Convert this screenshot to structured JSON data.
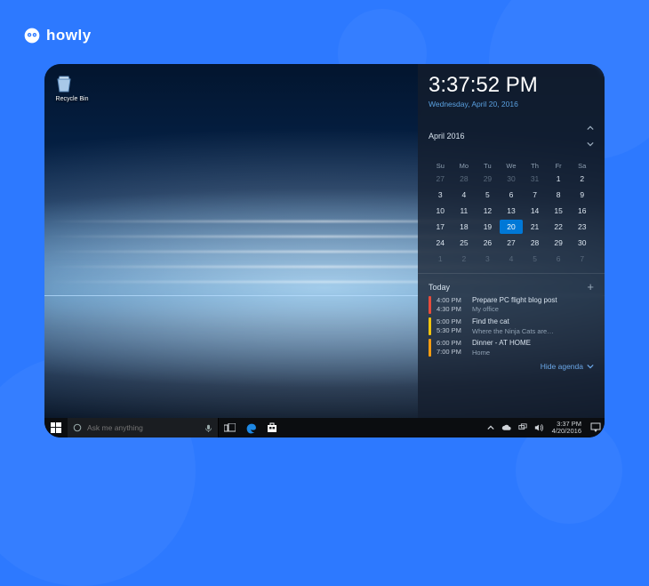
{
  "brand": {
    "name": "howly"
  },
  "desktop": {
    "recycle_label": "Recycle Bin"
  },
  "flyout": {
    "time": "3:37:52 PM",
    "date": "Wednesday, April 20, 2016",
    "month_label": "April 2016",
    "day_headers": [
      "Su",
      "Mo",
      "Tu",
      "We",
      "Th",
      "Fr",
      "Sa"
    ],
    "weeks": [
      [
        {
          "d": 27,
          "o": true
        },
        {
          "d": 28,
          "o": true
        },
        {
          "d": 29,
          "o": true
        },
        {
          "d": 30,
          "o": true
        },
        {
          "d": 31,
          "o": true
        },
        {
          "d": 1
        },
        {
          "d": 2
        }
      ],
      [
        {
          "d": 3
        },
        {
          "d": 4
        },
        {
          "d": 5
        },
        {
          "d": 6
        },
        {
          "d": 7
        },
        {
          "d": 8
        },
        {
          "d": 9
        }
      ],
      [
        {
          "d": 10
        },
        {
          "d": 11
        },
        {
          "d": 12
        },
        {
          "d": 13
        },
        {
          "d": 14
        },
        {
          "d": 15
        },
        {
          "d": 16
        }
      ],
      [
        {
          "d": 17
        },
        {
          "d": 18
        },
        {
          "d": 19
        },
        {
          "d": 20,
          "t": true
        },
        {
          "d": 21
        },
        {
          "d": 22
        },
        {
          "d": 23
        }
      ],
      [
        {
          "d": 24
        },
        {
          "d": 25
        },
        {
          "d": 26
        },
        {
          "d": 27
        },
        {
          "d": 28
        },
        {
          "d": 29
        },
        {
          "d": 30
        }
      ],
      [
        {
          "d": 1,
          "o": true
        },
        {
          "d": 2,
          "o": true
        },
        {
          "d": 3,
          "o": true
        },
        {
          "d": 4,
          "o": true
        },
        {
          "d": 5,
          "o": true
        },
        {
          "d": 6,
          "o": true
        },
        {
          "d": 7,
          "o": true
        }
      ]
    ],
    "agenda_title": "Today",
    "events": [
      {
        "color": "#e74c3c",
        "start": "4:00 PM",
        "end": "4:30 PM",
        "title": "Prepare PC flight blog post",
        "sub": "My office"
      },
      {
        "color": "#f1c40f",
        "start": "5:00 PM",
        "end": "5:30 PM",
        "title": "Find the cat",
        "sub": "Where the Ninja Cats are…"
      },
      {
        "color": "#f39c12",
        "start": "6:00 PM",
        "end": "7:00 PM",
        "title": "Dinner - AT HOME",
        "sub": "Home"
      }
    ],
    "hide_label": "Hide agenda"
  },
  "taskbar": {
    "search_placeholder": "Ask me anything",
    "tray_time": "3:37 PM",
    "tray_date": "4/20/2016"
  }
}
